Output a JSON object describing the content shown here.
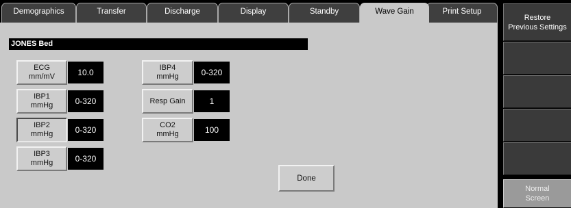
{
  "tabs": [
    {
      "label": "Demographics"
    },
    {
      "label": "Transfer"
    },
    {
      "label": "Discharge"
    },
    {
      "label": "Display"
    },
    {
      "label": "Standby"
    },
    {
      "label": "Wave Gain"
    },
    {
      "label": "Print Setup"
    }
  ],
  "bed_label": "JONES Bed",
  "gains": {
    "ecg": {
      "label": "ECG\nmm/mV",
      "value": "10.0"
    },
    "ibp1": {
      "label": "IBP1\nmmHg",
      "value": "0-320"
    },
    "ibp2": {
      "label": "IBP2\nmmHg",
      "value": "0-320"
    },
    "ibp3": {
      "label": "IBP3\nmmHg",
      "value": "0-320"
    },
    "ibp4": {
      "label": "IBP4\nmmHg",
      "value": "0-320"
    },
    "resp": {
      "label": "Resp Gain",
      "value": "1"
    },
    "co2": {
      "label": "CO2\nmmHg",
      "value": "100"
    }
  },
  "done_label": "Done",
  "side_buttons": {
    "restore": "Restore\nPrevious Settings",
    "normal": "Normal\nScreen"
  }
}
